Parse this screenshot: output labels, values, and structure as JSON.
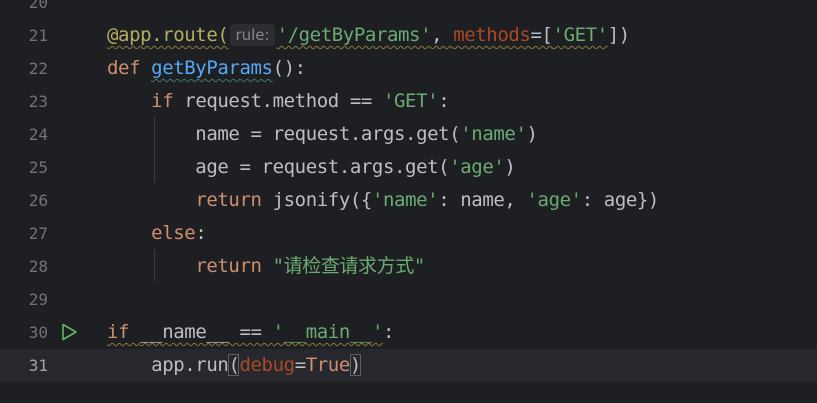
{
  "editor": {
    "lines": [
      {
        "num": "20",
        "tokens": []
      },
      {
        "num": "21",
        "tokens": [
          {
            "t": "@app.route(",
            "c": "deco warn"
          },
          {
            "t": "rule:",
            "c": "hint"
          },
          {
            "t": "'/getByParams'",
            "c": "str warn"
          },
          {
            "t": ", ",
            "c": "op warn"
          },
          {
            "t": "methods",
            "c": "param warn"
          },
          {
            "t": "=[",
            "c": "op warn"
          },
          {
            "t": "'GET'",
            "c": "str warn"
          },
          {
            "t": "])",
            "c": "op"
          }
        ]
      },
      {
        "num": "22",
        "tokens": [
          {
            "t": "def ",
            "c": "kw"
          },
          {
            "t": "getByParams",
            "c": "fn warn-fn"
          },
          {
            "t": "():",
            "c": "op"
          }
        ]
      },
      {
        "num": "23",
        "tokens": [
          {
            "t": "    ",
            "c": "op"
          },
          {
            "t": "if ",
            "c": "kw"
          },
          {
            "t": "request.method == ",
            "c": "op"
          },
          {
            "t": "'GET'",
            "c": "str"
          },
          {
            "t": ":",
            "c": "op"
          }
        ]
      },
      {
        "num": "24",
        "tokens": [
          {
            "t": "        name = request.args.get(",
            "c": "op"
          },
          {
            "t": "'name'",
            "c": "str"
          },
          {
            "t": ")",
            "c": "op"
          }
        ]
      },
      {
        "num": "25",
        "tokens": [
          {
            "t": "        age = request.args.get(",
            "c": "op"
          },
          {
            "t": "'age'",
            "c": "str"
          },
          {
            "t": ")",
            "c": "op"
          }
        ]
      },
      {
        "num": "26",
        "tokens": [
          {
            "t": "        ",
            "c": "op"
          },
          {
            "t": "return ",
            "c": "kw"
          },
          {
            "t": "jsonify({",
            "c": "op"
          },
          {
            "t": "'name'",
            "c": "str"
          },
          {
            "t": ": name, ",
            "c": "op"
          },
          {
            "t": "'age'",
            "c": "str"
          },
          {
            "t": ": age})",
            "c": "op"
          }
        ]
      },
      {
        "num": "27",
        "tokens": [
          {
            "t": "    ",
            "c": "op"
          },
          {
            "t": "else",
            "c": "kw"
          },
          {
            "t": ":",
            "c": "op"
          }
        ]
      },
      {
        "num": "28",
        "tokens": [
          {
            "t": "        ",
            "c": "op"
          },
          {
            "t": "return ",
            "c": "kw"
          },
          {
            "t": "\"请检查请求方式\"",
            "c": "str"
          }
        ]
      },
      {
        "num": "29",
        "tokens": []
      },
      {
        "num": "30",
        "run": true,
        "tokens": [
          {
            "t": "if ",
            "c": "kw warn"
          },
          {
            "t": "__name__ == ",
            "c": "op warn"
          },
          {
            "t": "'__main__'",
            "c": "str warn"
          },
          {
            "t": ":",
            "c": "op"
          }
        ]
      },
      {
        "num": "31",
        "current": true,
        "tokens": [
          {
            "t": "    app.run",
            "c": "op"
          },
          {
            "t": "(",
            "c": "op paren-hl"
          },
          {
            "t": "debug",
            "c": "param"
          },
          {
            "t": "=",
            "c": "op"
          },
          {
            "t": "True",
            "c": "kw"
          },
          {
            "t": ")",
            "c": "op paren-hl"
          }
        ]
      }
    ],
    "icons": {
      "run": "run-triangle-icon"
    },
    "colors": {
      "background": "#1e1f22",
      "current_line": "#26282e",
      "keyword": "#cf8e6d",
      "string": "#6aab73",
      "decorator": "#b3ae60",
      "function": "#56a8f5",
      "named_param": "#aa4926",
      "text": "#bcbec4",
      "line_number": "#6f737a",
      "run_icon": "#5fb865"
    }
  }
}
